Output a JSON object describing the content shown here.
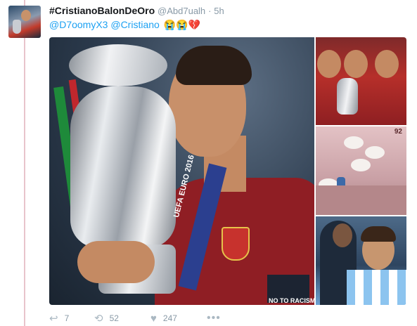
{
  "tweet": {
    "display_name": "#CristianoBalonDeOro",
    "handle": "@Abd7ualh",
    "separator": "·",
    "time": "5h",
    "mentions": [
      "@D7oomyX3",
      "@Cristiano"
    ],
    "emojis": "😭😭💔"
  },
  "media": {
    "main_photo": {
      "lanyard_text": "UEFA EURO 2016",
      "armband_text": "NO TO RACISM"
    },
    "side_photo_2_label": "92"
  },
  "actions": {
    "reply_count": "7",
    "retweet_count": "52",
    "like_count": "247",
    "more_label": "•••"
  },
  "colors": {
    "link": "#1da1f2",
    "muted": "#8899a6",
    "thread_line": "#e8c4cc"
  }
}
